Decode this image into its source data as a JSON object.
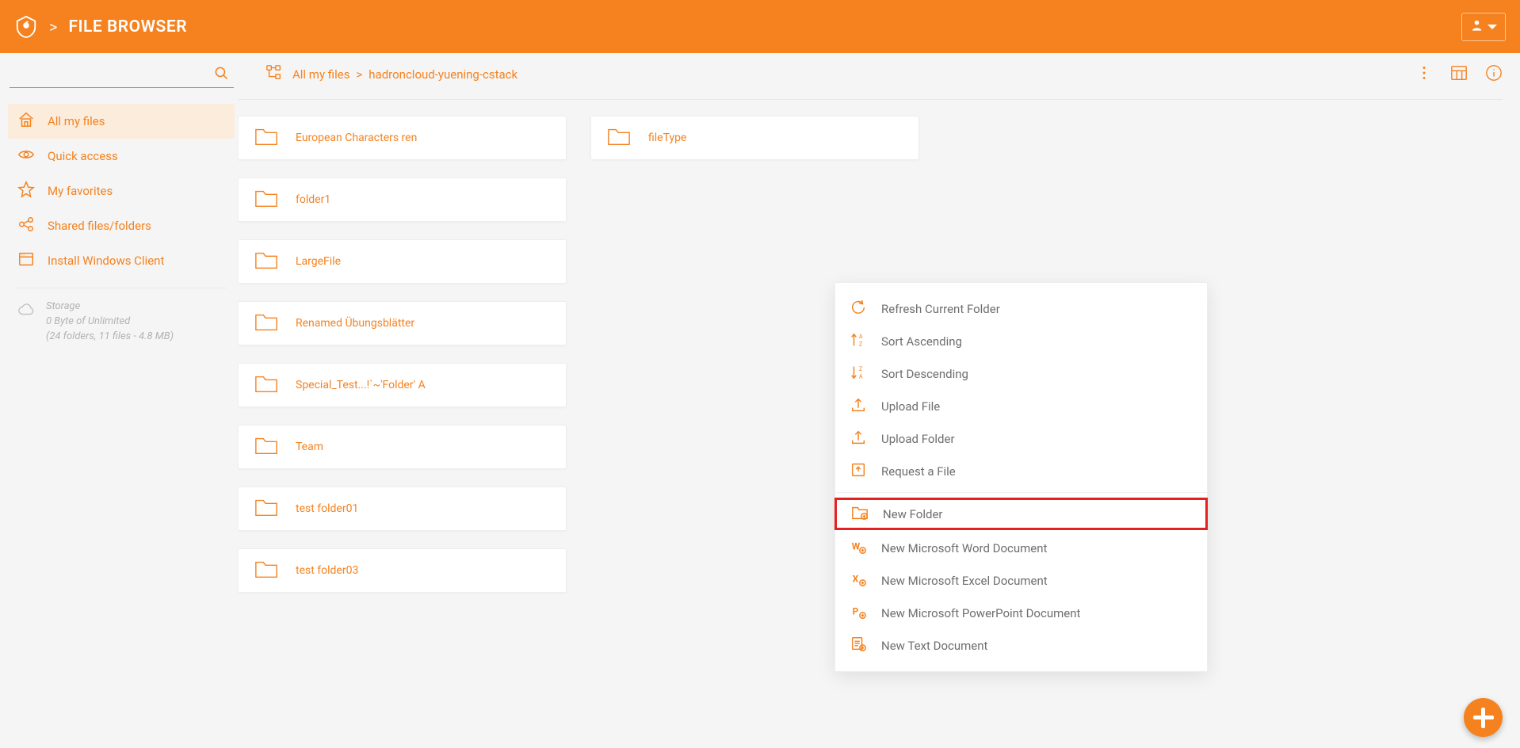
{
  "header": {
    "title": "FILE BROWSER",
    "sep": ">"
  },
  "breadcrumb": {
    "items": [
      "All my files",
      "hadroncloud-yuening-cstack"
    ],
    "sep": ">"
  },
  "sidebar": {
    "items": [
      {
        "label": "All my files",
        "icon": "home",
        "active": true
      },
      {
        "label": "Quick access",
        "icon": "eye",
        "active": false
      },
      {
        "label": "My favorites",
        "icon": "star",
        "active": false
      },
      {
        "label": "Shared files/folders",
        "icon": "share",
        "active": false
      },
      {
        "label": "Install Windows Client",
        "icon": "window",
        "active": false
      }
    ],
    "storage": {
      "title": "Storage",
      "line1": "0 Byte of Unlimited",
      "line2": "(24 folders, 11 files - 4.8 MB)"
    }
  },
  "folders": [
    {
      "label": "European Characters ren"
    },
    {
      "label": "fileType"
    },
    {
      "label": "folder1"
    },
    {
      "label": ""
    },
    {
      "label": "LargeFile"
    },
    {
      "label": ""
    },
    {
      "label": "Renamed Übungsblätter"
    },
    {
      "label": ""
    },
    {
      "label": "Special_Test...!`~'Folder' A"
    },
    {
      "label": ""
    },
    {
      "label": "Team"
    },
    {
      "label": ""
    },
    {
      "label": "test folder01"
    },
    {
      "label": ""
    },
    {
      "label": "test folder03"
    },
    {
      "label": ""
    }
  ],
  "context_menu": {
    "group1": [
      {
        "label": "Refresh Current Folder",
        "icon": "refresh"
      },
      {
        "label": "Sort Ascending",
        "icon": "sort-asc"
      },
      {
        "label": "Sort Descending",
        "icon": "sort-desc"
      },
      {
        "label": "Upload File",
        "icon": "upload"
      },
      {
        "label": "Upload Folder",
        "icon": "upload"
      },
      {
        "label": "Request a File",
        "icon": "request"
      }
    ],
    "group2": [
      {
        "label": "New Folder",
        "icon": "new-folder",
        "highlight": true
      },
      {
        "label": "New Microsoft Word Document",
        "icon": "word"
      },
      {
        "label": "New Microsoft Excel Document",
        "icon": "excel"
      },
      {
        "label": "New Microsoft PowerPoint Document",
        "icon": "ppt"
      },
      {
        "label": "New Text Document",
        "icon": "text"
      }
    ]
  }
}
